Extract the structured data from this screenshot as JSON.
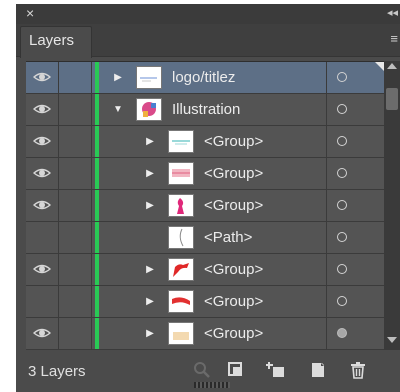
{
  "panel": {
    "close_glyph": "×",
    "collapse_glyph": "◂◂",
    "tab_label": "Layers",
    "menu_glyph": "≡",
    "layer_count": "3 Layers",
    "colors": {
      "selected_row": "#5d6f86",
      "layer_color_bar": "#29c855"
    }
  },
  "layers": [
    {
      "name": "logo/titlez",
      "visible": true,
      "depth": 0,
      "expander": "▶",
      "selected": true,
      "thumbnail": "logo-thumbnail"
    },
    {
      "name": "Illustration",
      "visible": true,
      "depth": 0,
      "expander": "▼",
      "selected": false,
      "thumbnail": "illustration-thumbnail"
    },
    {
      "name": "<Group>",
      "visible": true,
      "depth": 1,
      "expander": "▶",
      "selected": false,
      "thumbnail": "group-thumbnail"
    },
    {
      "name": "<Group>",
      "visible": true,
      "depth": 1,
      "expander": "▶",
      "selected": false,
      "thumbnail": "group-thumbnail"
    },
    {
      "name": "<Group>",
      "visible": true,
      "depth": 1,
      "expander": "▶",
      "selected": false,
      "thumbnail": "group-thumbnail"
    },
    {
      "name": "<Path>",
      "visible": false,
      "depth": 1,
      "expander": "",
      "selected": false,
      "thumbnail": "path-thumbnail"
    },
    {
      "name": "<Group>",
      "visible": true,
      "depth": 1,
      "expander": "▶",
      "selected": false,
      "thumbnail": "group-thumbnail"
    },
    {
      "name": "<Group>",
      "visible": false,
      "depth": 1,
      "expander": "▶",
      "selected": false,
      "thumbnail": "group-thumbnail"
    },
    {
      "name": "<Group>",
      "visible": true,
      "depth": 1,
      "expander": "▶",
      "selected": false,
      "thumbnail": "group-thumbnail",
      "target_filled": true
    }
  ],
  "toolbar": {
    "icons": [
      "locate-object-icon",
      "make-clipping-mask-icon",
      "create-sublayer-icon",
      "create-new-layer-icon",
      "delete-layer-icon"
    ]
  }
}
